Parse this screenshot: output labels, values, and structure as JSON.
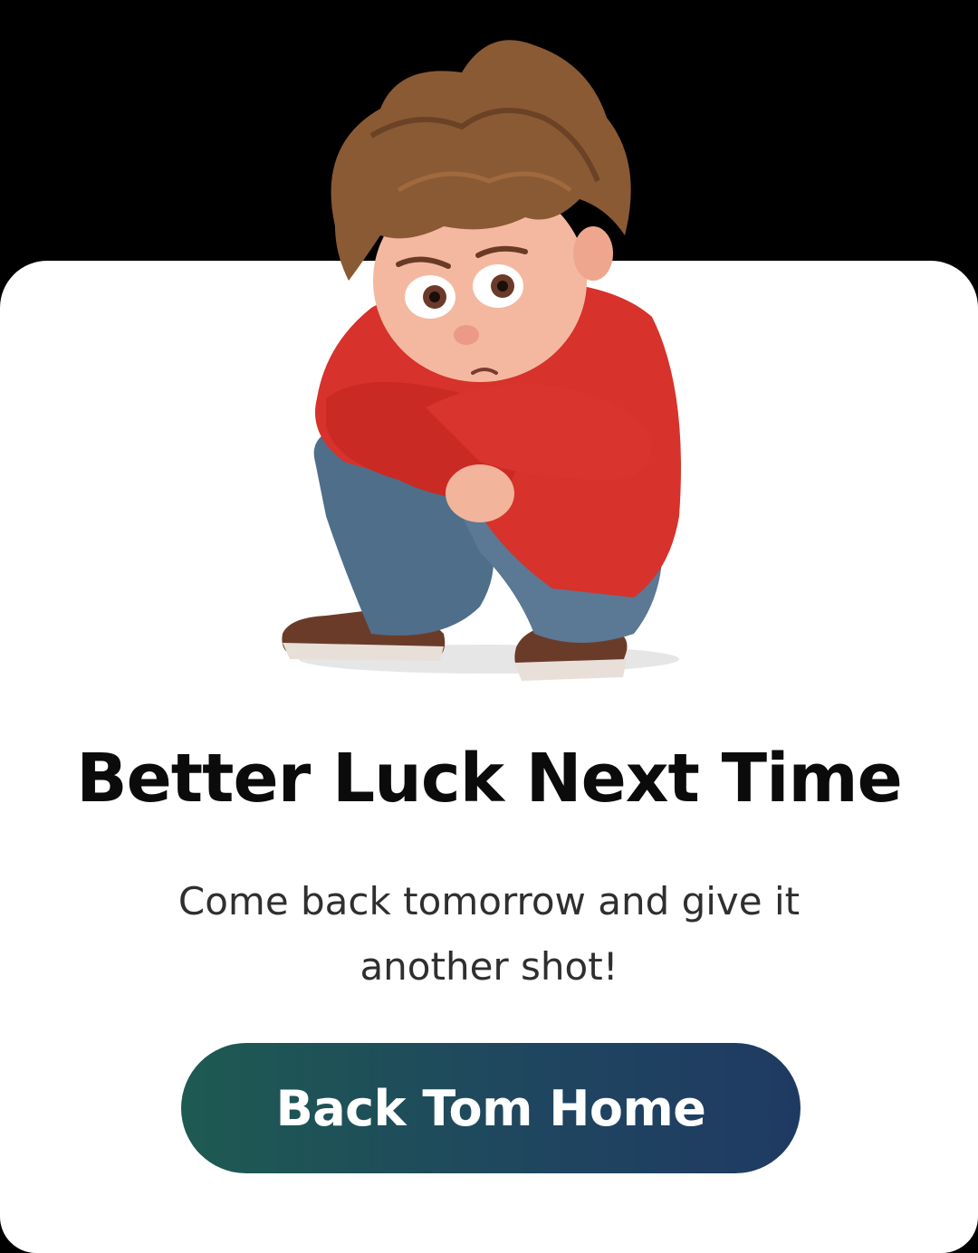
{
  "dialog": {
    "illustration_icon": "sad-boy-sitting-icon",
    "title": "Better Luck Next Time",
    "message": "Come back tomorrow and give it another shot!",
    "button_label": "Back Tom Home"
  },
  "colors": {
    "background": "#000000",
    "card": "#ffffff",
    "title": "#0b0b0b",
    "message": "#2f2f2f",
    "button_gradient_start": "#1e5a52",
    "button_gradient_end": "#1f3a62",
    "button_text": "#ffffff"
  }
}
